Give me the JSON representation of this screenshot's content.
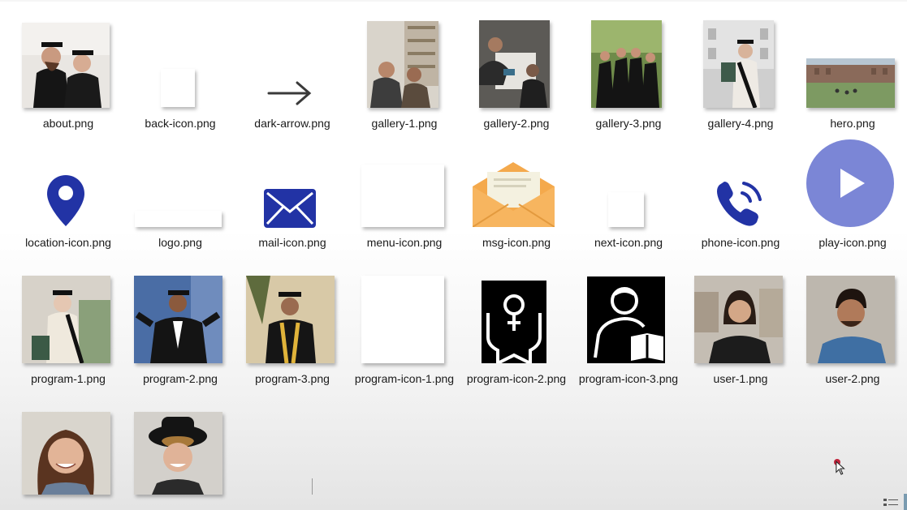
{
  "files": [
    {
      "label": "about.png",
      "kind": "photo",
      "icon": "graduates-photo"
    },
    {
      "label": "back-icon.png",
      "kind": "blank",
      "icon": "blank-image"
    },
    {
      "label": "dark-arrow.png",
      "kind": "icon",
      "icon": "arrow-right-icon"
    },
    {
      "label": "gallery-1.png",
      "kind": "photo",
      "icon": "students-library-photo"
    },
    {
      "label": "gallery-2.png",
      "kind": "photo",
      "icon": "students-desk-photo"
    },
    {
      "label": "gallery-3.png",
      "kind": "photo",
      "icon": "graduates-group-photo"
    },
    {
      "label": "gallery-4.png",
      "kind": "photo",
      "icon": "graduate-diploma-photo"
    },
    {
      "label": "hero.png",
      "kind": "photo",
      "icon": "campus-lawn-photo"
    },
    {
      "label": "location-icon.png",
      "kind": "icon",
      "icon": "location-pin-icon"
    },
    {
      "label": "logo.png",
      "kind": "blank",
      "icon": "blank-image"
    },
    {
      "label": "mail-icon.png",
      "kind": "icon",
      "icon": "mail-icon"
    },
    {
      "label": "menu-icon.png",
      "kind": "blank",
      "icon": "blank-image"
    },
    {
      "label": "msg-icon.png",
      "kind": "icon",
      "icon": "envelope-letter-icon"
    },
    {
      "label": "next-icon.png",
      "kind": "blank",
      "icon": "blank-image"
    },
    {
      "label": "phone-icon.png",
      "kind": "icon",
      "icon": "phone-call-icon"
    },
    {
      "label": "play-icon.png",
      "kind": "icon",
      "icon": "play-button-icon"
    },
    {
      "label": "program-1.png",
      "kind": "photo",
      "icon": "graduate-woman-photo"
    },
    {
      "label": "program-2.png",
      "kind": "photo",
      "icon": "graduate-man-photo"
    },
    {
      "label": "program-3.png",
      "kind": "photo",
      "icon": "graduate-cap-photo"
    },
    {
      "label": "program-icon-1.png",
      "kind": "blank",
      "icon": "blank-image"
    },
    {
      "label": "program-icon-2.png",
      "kind": "icon",
      "icon": "female-badge-icon"
    },
    {
      "label": "program-icon-3.png",
      "kind": "icon",
      "icon": "reader-icon"
    },
    {
      "label": "user-1.png",
      "kind": "photo",
      "icon": "woman-portrait-photo"
    },
    {
      "label": "user-2.png",
      "kind": "photo",
      "icon": "man-portrait-photo"
    },
    {
      "label": "",
      "kind": "photo",
      "icon": "smiling-woman-photo"
    },
    {
      "label": "",
      "kind": "photo",
      "icon": "man-hat-photo"
    }
  ],
  "colors": {
    "icon_blue": "#2233a5",
    "play_purple": "#7b86d6",
    "msg_orange": "#f4a94c",
    "label_text": "#1a1a1a"
  }
}
